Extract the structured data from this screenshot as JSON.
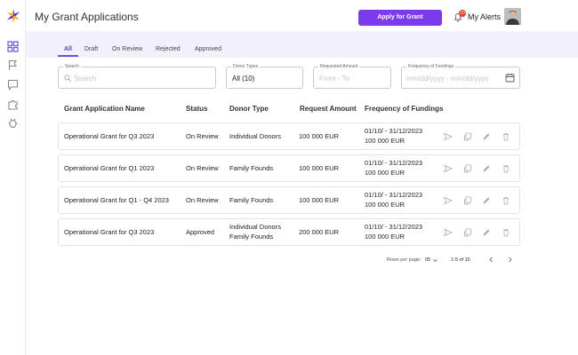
{
  "header": {
    "title": "My Grant Applications",
    "apply_label": "Apply for Grant",
    "alerts_label": "My Alerts",
    "alerts_count": "10"
  },
  "tabs": [
    {
      "label": "All"
    },
    {
      "label": "Draft"
    },
    {
      "label": "On Review"
    },
    {
      "label": "Rejected"
    },
    {
      "label": "Approved"
    }
  ],
  "filters": {
    "search": {
      "label": "Search",
      "placeholder": "Search"
    },
    "donor_types": {
      "label": "Donor Types",
      "value": "All (10)"
    },
    "requested_amount": {
      "label": "Requested Amount",
      "placeholder": "From - To"
    },
    "frequency": {
      "label": "Frequency of Fundings",
      "placeholder": "mm/dd/yyyy - mm/dd/yyyy"
    }
  },
  "table": {
    "columns": [
      "Grant Application Name",
      "Status",
      "Donor Type",
      "Request Amount",
      "Frequency of Fundings"
    ],
    "rows": [
      {
        "name": "Operational Grant for Q3 2023",
        "status": "On Review",
        "donor_line1": "Individual Donors",
        "donor_line2": "",
        "amount": "100 000 EUR",
        "freq_line1": "01/10/ - 31/12/2023",
        "freq_line2": "100 000 EUR"
      },
      {
        "name": "Operational Grant for Q1 2023",
        "status": "On Review",
        "donor_line1": "Family Founds",
        "donor_line2": "",
        "amount": "100 000 EUR",
        "freq_line1": "01/10/ - 31/12/2023",
        "freq_line2": "100 000 EUR"
      },
      {
        "name": "Operational Grant for Q1 - Q4 2023",
        "status": "On Review",
        "donor_line1": "Family Founds",
        "donor_line2": "",
        "amount": "100 000 EUR",
        "freq_line1": "01/10/ - 31/12/2023",
        "freq_line2": "100 000 EUR"
      },
      {
        "name": "Operational Grant for Q3 2023",
        "status": "Approved",
        "donor_line1": "Individual Donors",
        "donor_line2": "Family Founds",
        "amount": "200 000 EUR",
        "freq_line1": "01/10/ - 31/12/2023",
        "freq_line2": "100 000 EUR"
      }
    ]
  },
  "pagination": {
    "rows_per_page_label": "Rows per page:",
    "rows_per_page_value": "05",
    "range": "1-5 of 15"
  },
  "colors": {
    "accent": "#7c3aed",
    "tab_bg": "#f2f1fb",
    "badge": "#e53935"
  }
}
